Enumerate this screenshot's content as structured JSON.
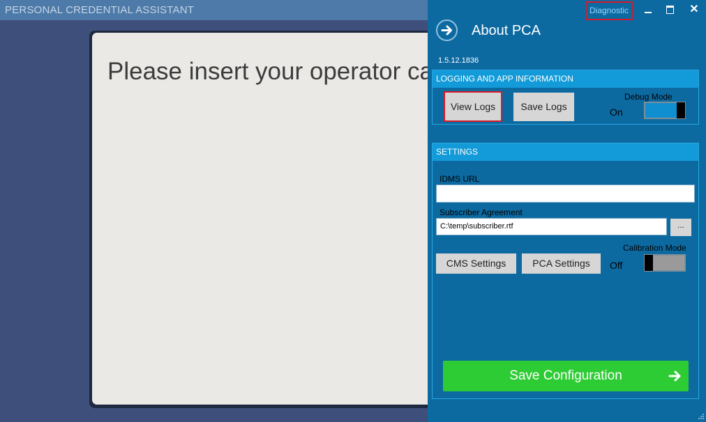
{
  "app": {
    "title": "PERSONAL CREDENTIAL ASSISTANT"
  },
  "main": {
    "prompt": "Please insert your operator car"
  },
  "panel": {
    "diagnostic_label": "Diagnostic",
    "title": "About PCA",
    "version": "1.5.12.1836",
    "close_glyph": "✕"
  },
  "logging": {
    "header": "LOGGING AND APP INFORMATION",
    "view_logs": "View Logs",
    "save_logs": "Save Logs",
    "debug_mode_label": "Debug Mode",
    "debug_mode_state": "On"
  },
  "settings": {
    "header": "SETTINGS",
    "idms_url_label": "IDMS URL",
    "idms_url_value": "",
    "subscriber_label": "Subscriber Agreement",
    "subscriber_value": "C:\\temp\\subscriber.rtf",
    "browse_label": "...",
    "cms_settings": "CMS Settings",
    "pca_settings": "PCA Settings",
    "calibration_label": "Calibration Mode",
    "calibration_state": "Off"
  },
  "footer": {
    "save_configuration": "Save Configuration"
  },
  "colors": {
    "panel_bg": "#0d6aa1",
    "section_header": "#129bd8",
    "save_green": "#2ecc34",
    "highlight_red": "#d9192a"
  }
}
